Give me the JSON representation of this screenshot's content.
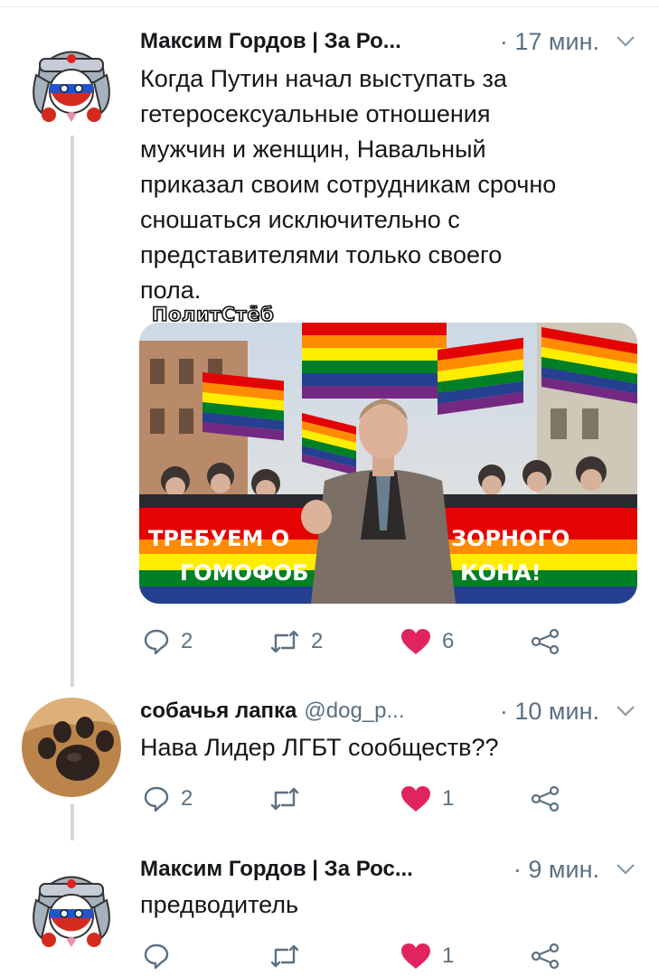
{
  "tweets": [
    {
      "author": "Максим Гордов | За Ро...",
      "time": "· 17 мин.",
      "text": "Когда Путин начал выступать за\nгетеросексуальные отношения\nмужчин и женщин, Навальный\nприказал своим сотрудникам срочно\nсношаться исключительно с\nпредставителями только  своего\nпола.",
      "media": {
        "watermark": "ПолитСтёб",
        "banner_line1_left": "ТРЕБУЕМ О",
        "banner_line1_right": "ЗОРНОГО",
        "banner_line2_left": "ГОМОФОБ",
        "banner_line2_right": "КОНА!"
      },
      "actions": {
        "replies": "2",
        "retweets": "2",
        "likes": "6"
      },
      "like_color": "#e0245e"
    },
    {
      "author": "собачья лапка",
      "handle": "@dog_p...",
      "time": "· 10 мин.",
      "text": "Нава Лидер ЛГБТ сообществ??",
      "actions": {
        "replies": "2",
        "retweets": "",
        "likes": "1"
      },
      "like_color": "#e0245e"
    },
    {
      "author": "Максим Гордов | За Рос...",
      "time": "· 9 мин.",
      "text": "предводитель",
      "actions": {
        "replies": "",
        "retweets": "",
        "likes": "1"
      },
      "like_color": "#e0245e"
    }
  ],
  "icons": [
    "reply-icon",
    "retweet-icon",
    "like-icon",
    "share-icon",
    "chevron-down-icon"
  ]
}
